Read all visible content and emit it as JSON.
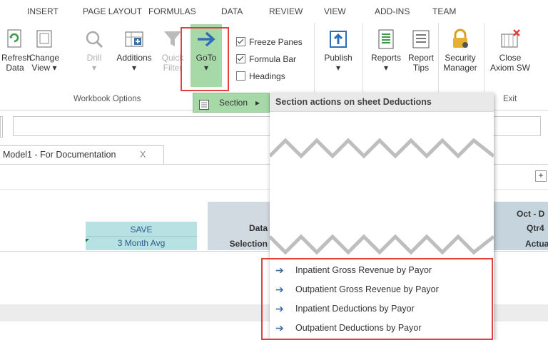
{
  "tabs": [
    "INSERT",
    "PAGE LAYOUT",
    "FORMULAS",
    "DATA",
    "REVIEW",
    "VIEW",
    "ADD-INS",
    "TEAM"
  ],
  "ribbon": {
    "refresh": [
      "Refresh",
      "Data"
    ],
    "change": [
      "Change",
      "View ▾"
    ],
    "drill": [
      "Drill",
      "▾"
    ],
    "additions": [
      "Additions",
      "▾"
    ],
    "quick": [
      "Quick",
      "Filter"
    ],
    "goto": [
      "GoTo",
      "▾"
    ],
    "freeze": "Freeze Panes",
    "formula_bar": "Formula Bar",
    "headings": "Headings",
    "publish": [
      "Publish",
      "▾"
    ],
    "reports": [
      "Reports",
      "▾"
    ],
    "report_tips": [
      "Report",
      "Tips"
    ],
    "security": [
      "Security",
      "Manager"
    ],
    "close": [
      "Close",
      "Axiom SW"
    ],
    "group_workbook": "Workbook Options",
    "group_exit": "Exit",
    "section_btn": "Section",
    "section_arrow": "▸"
  },
  "doc_tab": {
    "label": "Model1 - For Documentation",
    "close": "X"
  },
  "grid": {
    "save": "SAVE",
    "month_avg": "3 Month Avg",
    "data": "Data",
    "selection": "Selection",
    "oct": "Oct - D",
    "qtr": "Qtr4",
    "actual": "Actua",
    "plus": "+"
  },
  "menu": {
    "header": "Section actions on sheet Deductions",
    "items": [
      "Inpatient Gross Revenue by Payor",
      "Outpatient Gross Revenue by Payor",
      "Inpatient Deductions by Payor",
      "Outpatient Deductions by Payor"
    ],
    "arrow": "➔"
  },
  "colors": {
    "accent": "#3a6ea5",
    "highlight": "#e0403f",
    "goto_bg": "#a6d8a8",
    "grid_header": "#b7e1e3",
    "gray_header": "#d2dae1"
  }
}
